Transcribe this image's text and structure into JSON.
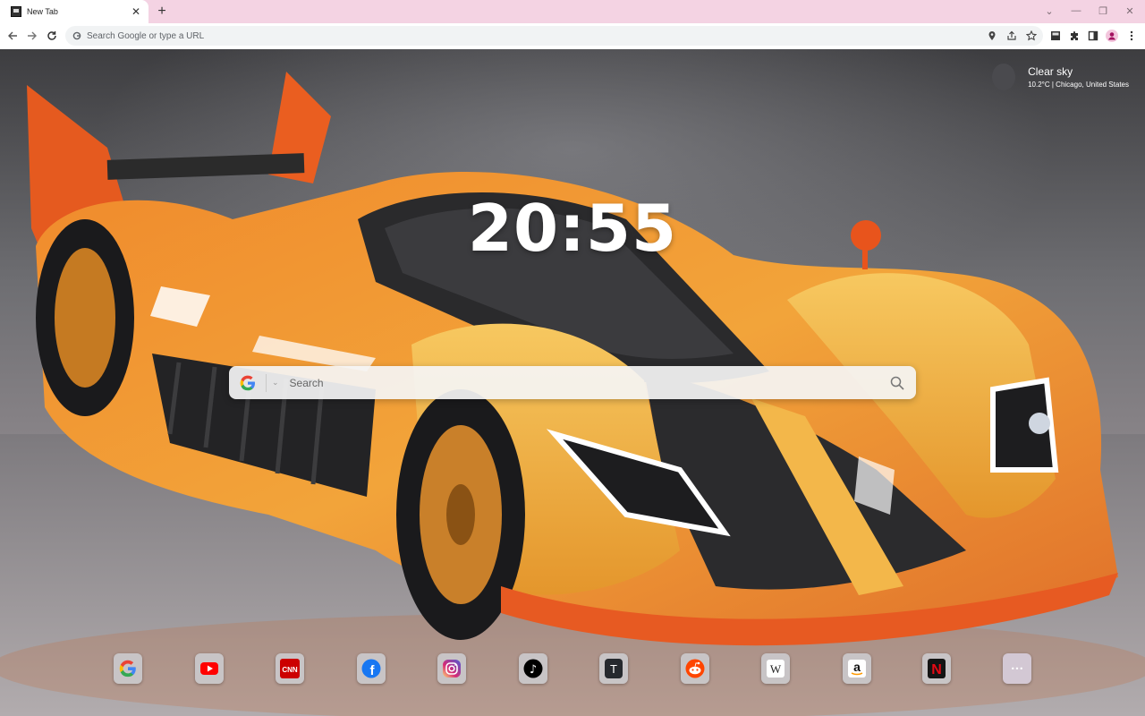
{
  "browser": {
    "tab_title": "New Tab",
    "omnibox_placeholder": "Search Google or type a URL"
  },
  "weather": {
    "condition": "Clear sky",
    "detail": "10.2°C | Chicago, United States"
  },
  "clock": {
    "time": "20:55"
  },
  "search": {
    "placeholder": "Search"
  },
  "shortcuts": [
    {
      "name": "Google",
      "icon": "google-icon"
    },
    {
      "name": "YouTube",
      "icon": "youtube-icon"
    },
    {
      "name": "CNN",
      "icon": "cnn-icon",
      "text": "CNN"
    },
    {
      "name": "Facebook",
      "icon": "facebook-icon",
      "text": "f"
    },
    {
      "name": "Instagram",
      "icon": "instagram-icon"
    },
    {
      "name": "TikTok",
      "icon": "tiktok-icon",
      "text": "♪"
    },
    {
      "name": "T",
      "icon": "t-icon",
      "text": "T"
    },
    {
      "name": "Reddit",
      "icon": "reddit-icon"
    },
    {
      "name": "Wikipedia",
      "icon": "wikipedia-icon",
      "text": "W"
    },
    {
      "name": "Amazon",
      "icon": "amazon-icon",
      "text": "a"
    },
    {
      "name": "Netflix",
      "icon": "netflix-icon",
      "text": "N"
    },
    {
      "name": "More",
      "icon": "more-icon",
      "text": "•••"
    }
  ],
  "colors": {
    "tabstrip": "#f4d3e3",
    "car_orange": "#e8772a",
    "car_yellow": "#f0b23c"
  }
}
